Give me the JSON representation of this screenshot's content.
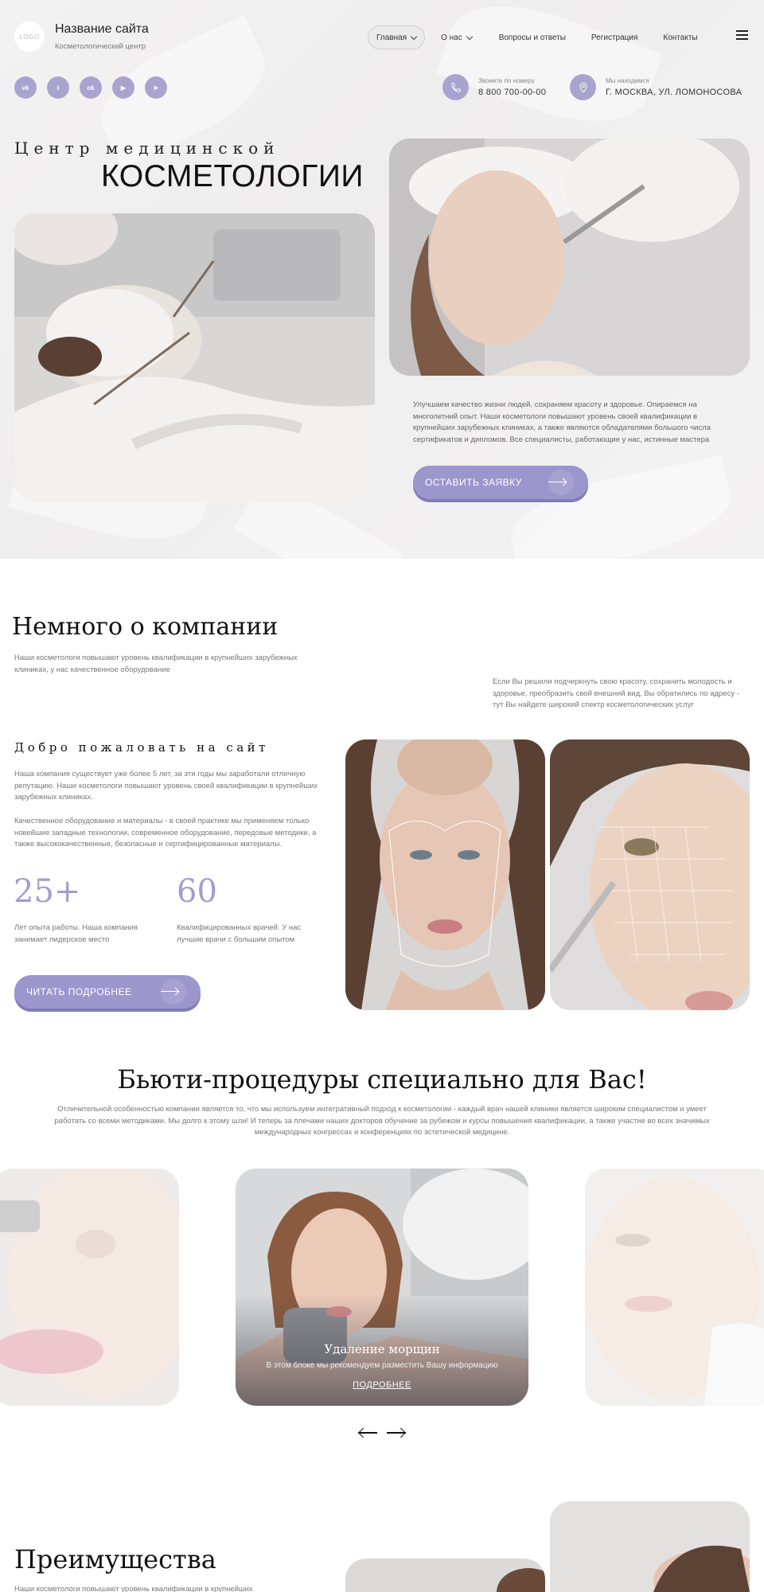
{
  "header": {
    "logo": "LOGO",
    "site_name": "Название сайта",
    "site_sub": "Косметологический центр",
    "nav": [
      {
        "label": "Главная"
      },
      {
        "label": "О нас"
      },
      {
        "label": "Вопросы и ответы"
      },
      {
        "label": "Регистрация"
      },
      {
        "label": "Контакты"
      }
    ],
    "socials": [
      "vk-icon",
      "twitter-icon",
      "odnoklassniki-icon",
      "youtube-icon",
      "telegram-icon"
    ],
    "social_glyphs": [
      "vk",
      "t",
      "ok",
      "▶",
      "➤"
    ],
    "phone_caption": "Звоните по номеру",
    "phone": "8 800 700-00-00",
    "address_caption": "Мы находимся",
    "address": "Г. МОСКВА, УЛ. ЛОМОНОСОВА"
  },
  "hero": {
    "title_line1": "Центр медицинской",
    "title_line2": "КОСМЕТОЛОГИИ",
    "text": "Улучшаем качество жизни людей, сохраняем красоту и здоровье. Опираемся на многолетний опыт. Наши косметологи повышают уровень своей квалификации в крупнейших зарубежных клиниках, а также являются обладателями большого числа сертификатов и дипломов. Все специалисты, работающие у нас, истинные мастера",
    "button": "ОСТАВИТЬ ЗАЯВКУ"
  },
  "about": {
    "title": "Немного о компании",
    "intro": "Наши косметологи повышают уровень квалификации в крупнейших зарубежных клиниках, у нас качественное оборудование",
    "side_text": "Если Вы решили подчеркнуть свою красоту, сохранить молодость и здоровье, преобразить свой внешний вид, Вы обратились по адресу - тут Вы найдете широкий спектр  косметологических услуг",
    "welcome_title": "Добро пожаловать на сайт",
    "p1": "Наша компания существует уже более 5 лет, за эти годы мы заработали отличную репутацию. Наши косметологи повышают уровень своей квалификации в крупнейших зарубежных клиниках.",
    "p2": "Качественное оборудование и материалы - в своей практике мы применяем только новейшие западные технологии, современное оборудование, передовые методики, а также высококачественные, безопасные и сертифицированные материалы.",
    "stats": [
      {
        "number": "25+",
        "label": "Лет опыта работы.  Наша компания занимает лидерское место"
      },
      {
        "number": "60",
        "label": "Квалифицированных врачей. У нас лучшие врачи с большим опытом"
      }
    ],
    "button": "ЧИТАТЬ ПОДРОБНЕЕ"
  },
  "procedures": {
    "title": "Бьюти-процедуры специально для Вас!",
    "text": "Отличительной особенностью компании является то, что мы используем интегративный подход к косметологии - каждый врач нашей клиники является широким специалистом и умеет работать со всеми методиками. Мы долго к этому шли! И теперь за плечами наших докторов обучение за рубежом и курсы повышения квалификации, а также участие во всех значимых международных конгрессах и конференциях по эстетической медицине.",
    "card_title": "Удаление морщин",
    "card_desc": "В этом блоке мы рекомендуем разместить Вашу информацию",
    "card_link": "ПОДРОБНЕЕ"
  },
  "advantages": {
    "title": "Преимущества",
    "text": "Наши косметологи повышают уровень квалификации в крупнейших"
  },
  "colors": {
    "accent": "#9b96cc",
    "accent_dark": "#817bb8",
    "social": "#a9a4cf",
    "stat": "#a29dd0"
  }
}
